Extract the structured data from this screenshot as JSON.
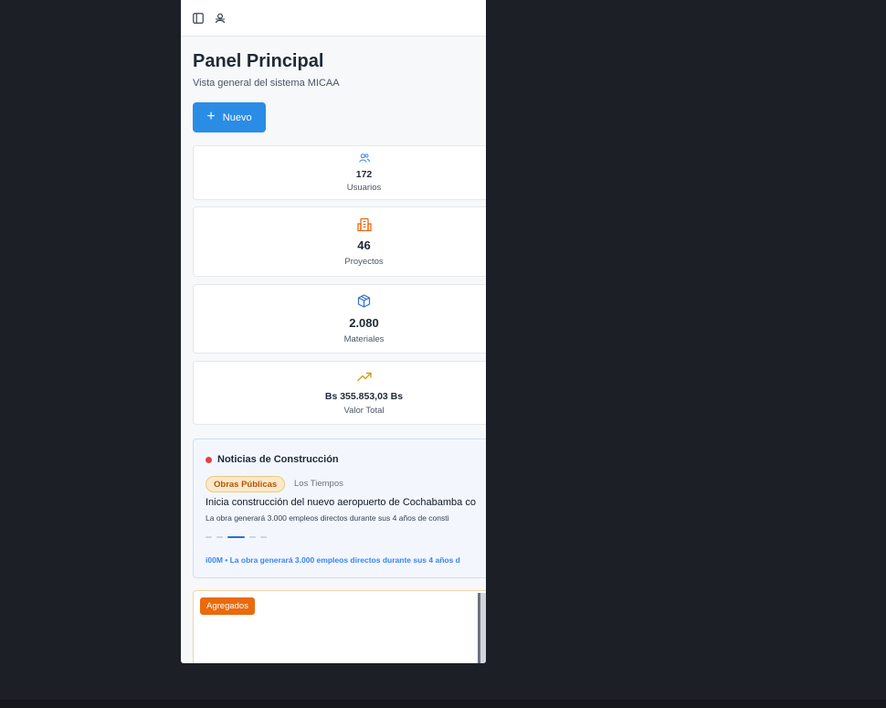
{
  "header": {
    "icons": [
      "sidebar-toggle-icon",
      "user-status-icon"
    ]
  },
  "page": {
    "title": "Panel Principal",
    "subtitle": "Vista general del sistema MICAA",
    "new_button": "Nuevo"
  },
  "stats": [
    {
      "icon": "users-icon",
      "value": "172",
      "label": "Usuarios",
      "color": "#3b82f6"
    },
    {
      "icon": "building-icon",
      "value": "46",
      "label": "Proyectos",
      "color": "#ea6a0c"
    },
    {
      "icon": "package-icon",
      "value": "2.080",
      "label": "Materiales",
      "color": "#2b6fd1"
    },
    {
      "icon": "trending-up-icon",
      "value": "Bs 355.853,03 Bs",
      "label": "Valor Total",
      "color": "#d4a017"
    }
  ],
  "news": {
    "title": "Noticias de Construcción",
    "tag": "Obras Públicas",
    "source": "Los Tiempos",
    "headline": "Inicia construcción del nuevo aeropuerto de Cochabamba co",
    "summary": "La obra generará 3.000 empleos directos durante sus 4 años de consti",
    "ticker": "i00M • La obra generará 3.000 empleos directos durante sus 4 años d",
    "slides": 5,
    "active_slide": 3
  },
  "promo": {
    "badge": "Agregados"
  }
}
